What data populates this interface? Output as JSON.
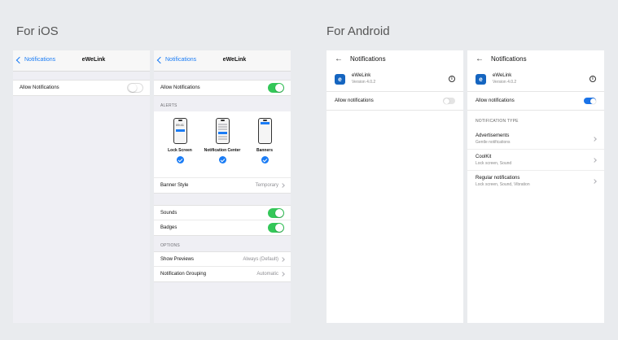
{
  "sections": {
    "ios_title": "For iOS",
    "android_title": "For Android"
  },
  "ios1": {
    "back_label": "Notifications",
    "title": "eWeLink",
    "allow_label": "Allow Notifications",
    "allow_on": false
  },
  "ios2": {
    "back_label": "Notifications",
    "title": "eWeLink",
    "allow_label": "Allow Notifications",
    "allow_on": true,
    "alerts_label": "ALERTS",
    "alerts": [
      {
        "label": "Lock Screen",
        "time": "09:41"
      },
      {
        "label": "Notification Center"
      },
      {
        "label": "Banners"
      }
    ],
    "banner_style_label": "Banner Style",
    "banner_style_value": "Temporary",
    "sounds_label": "Sounds",
    "badges_label": "Badges",
    "options_label": "OPTIONS",
    "show_previews_label": "Show Previews",
    "show_previews_value": "Always (Default)",
    "grouping_label": "Notification Grouping",
    "grouping_value": "Automatic"
  },
  "android1": {
    "title": "Notifications",
    "app_icon_letter": "e",
    "app_name": "eWeLink",
    "app_version": "Version 4.0.2",
    "allow_label": "Allow notifications",
    "allow_on": false
  },
  "android2": {
    "title": "Notifications",
    "app_icon_letter": "e",
    "app_name": "eWeLink",
    "app_version": "Version 4.0.2",
    "allow_label": "Allow notifications",
    "allow_on": true,
    "type_label": "NOTIFICATION TYPE",
    "types": [
      {
        "title": "Advertisements",
        "sub": "Gentle notifications"
      },
      {
        "title": "CoolKit",
        "sub": "Lock screen, Sound"
      },
      {
        "title": "Regular notifications",
        "sub": "Lock screen, Sound, Vibration"
      }
    ]
  },
  "colors": {
    "ios_blue": "#1a7cf5",
    "ios_green": "#34c759",
    "android_blue": "#1a73e8",
    "app_icon": "#1565c0"
  }
}
